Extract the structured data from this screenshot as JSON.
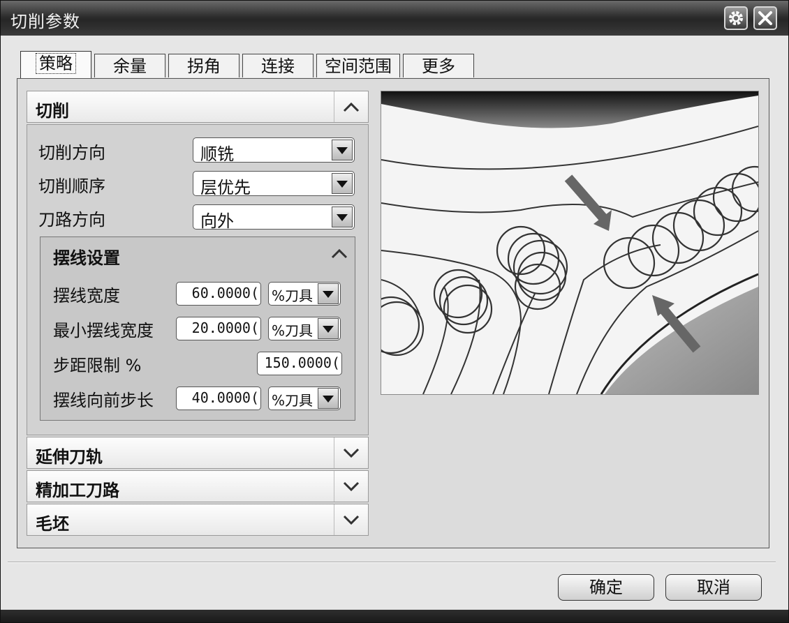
{
  "window": {
    "title": "切削参数"
  },
  "tabs": [
    {
      "label": "策略",
      "active": true
    },
    {
      "label": "余量"
    },
    {
      "label": "拐角"
    },
    {
      "label": "连接"
    },
    {
      "label": "空间范围"
    },
    {
      "label": "更多"
    }
  ],
  "section_cut": {
    "title": "切削",
    "fields": [
      {
        "label": "切削方向",
        "value": "顺铣"
      },
      {
        "label": "切削顺序",
        "value": "层优先"
      },
      {
        "label": "刀路方向",
        "value": "向外"
      }
    ],
    "trochoid": {
      "title": "摆线设置",
      "rows": [
        {
          "label": "摆线宽度",
          "value": "60.0000(",
          "unit": "%刀具"
        },
        {
          "label": "最小摆线宽度",
          "value": "20.0000(",
          "unit": "%刀具"
        },
        {
          "label": "步距限制 %",
          "value": "150.0000("
        },
        {
          "label": "摆线向前步长",
          "value": "40.0000(",
          "unit": "%刀具"
        }
      ]
    }
  },
  "collapsed_sections": [
    "延伸刀轨",
    "精加工刀路",
    "毛坯"
  ],
  "buttons": {
    "ok": "确定",
    "cancel": "取消"
  },
  "icons": {
    "gear": "gear-icon",
    "close": "close-icon",
    "expand_up": "chevron-up-icon",
    "expand_down": "chevron-down-icon",
    "dropdown": "dropdown-arrow-icon"
  }
}
